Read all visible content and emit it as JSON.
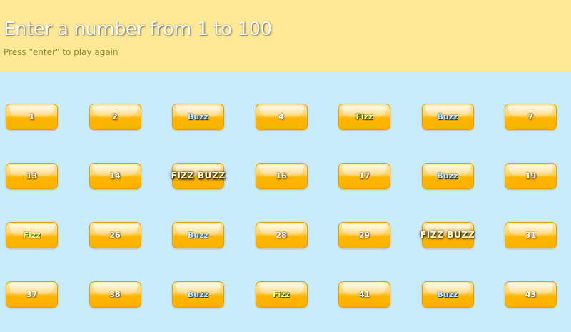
{
  "header": {
    "title": "Enter a number from 1 to 100",
    "subtitle": "Press \"enter\" to play again"
  },
  "colors": {
    "header_background": "#ffe896",
    "page_background": "#c9ecfa",
    "tile_orange": "#ffb000"
  },
  "tiles": [
    {
      "label": "1",
      "kind": "number"
    },
    {
      "label": "2",
      "kind": "number"
    },
    {
      "label": "Buzz",
      "kind": "buzz"
    },
    {
      "label": "4",
      "kind": "number"
    },
    {
      "label": "Fizz",
      "kind": "fizz"
    },
    {
      "label": "Buzz",
      "kind": "buzz"
    },
    {
      "label": "7",
      "kind": "number"
    },
    {
      "label": "13",
      "kind": "number"
    },
    {
      "label": "14",
      "kind": "number"
    },
    {
      "label": "FIZZ BUZZ",
      "kind": "fizzbuzz"
    },
    {
      "label": "16",
      "kind": "number"
    },
    {
      "label": "17",
      "kind": "number"
    },
    {
      "label": "Buzz",
      "kind": "buzz"
    },
    {
      "label": "19",
      "kind": "number"
    },
    {
      "label": "Fizz",
      "kind": "fizz"
    },
    {
      "label": "26",
      "kind": "number"
    },
    {
      "label": "Buzz",
      "kind": "buzz"
    },
    {
      "label": "28",
      "kind": "number"
    },
    {
      "label": "29",
      "kind": "number"
    },
    {
      "label": "FIZZ BUZZ",
      "kind": "fizzbuzz"
    },
    {
      "label": "31",
      "kind": "number"
    },
    {
      "label": "37",
      "kind": "number"
    },
    {
      "label": "38",
      "kind": "number"
    },
    {
      "label": "Buzz",
      "kind": "buzz"
    },
    {
      "label": "Fizz",
      "kind": "fizz"
    },
    {
      "label": "41",
      "kind": "number"
    },
    {
      "label": "Buzz",
      "kind": "buzz"
    },
    {
      "label": "43",
      "kind": "number"
    }
  ]
}
